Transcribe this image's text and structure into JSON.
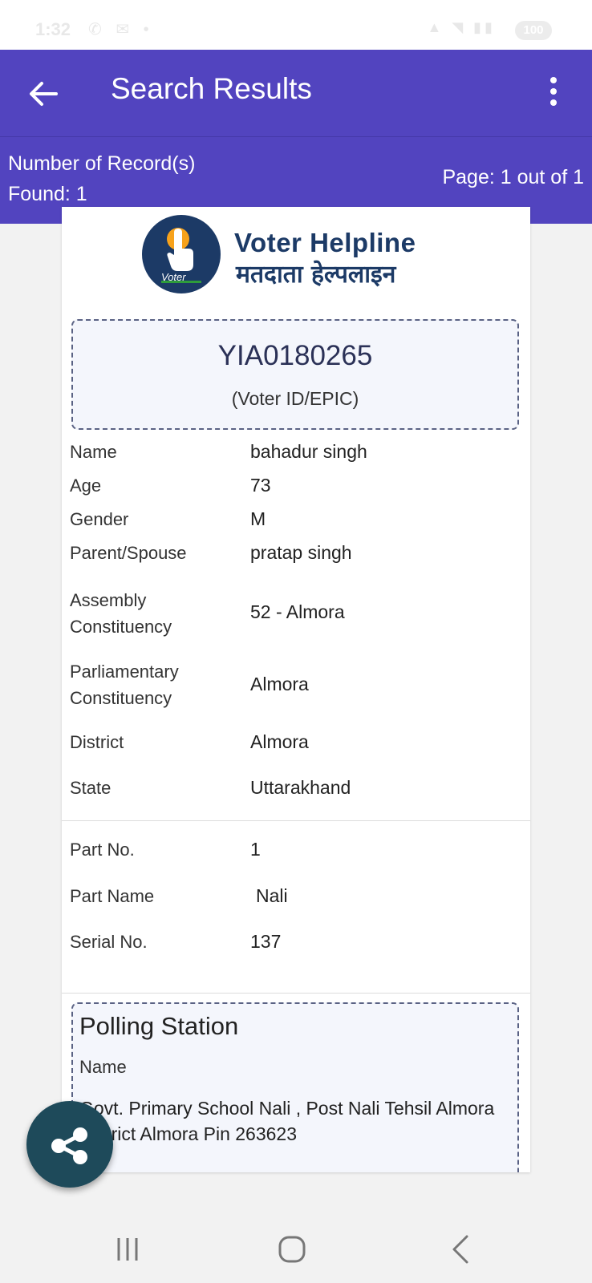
{
  "status_bar": {
    "time": "1:32",
    "battery": "100"
  },
  "app_bar": {
    "title": "Search Results"
  },
  "summary": {
    "records_found": "Number of Record(s) Found: 1",
    "page": "Page: 1 out of 1"
  },
  "logo": {
    "voter_badge": "Voter",
    "title_en": "Voter Helpline",
    "title_hi": "मतदाता हेल्पलाइन"
  },
  "epic": {
    "number": "YIA0180265",
    "label": "(Voter ID/EPIC)"
  },
  "details": [
    {
      "label": "Name",
      "value": "bahadur singh"
    },
    {
      "label": "Age",
      "value": "73"
    },
    {
      "label": "Gender",
      "value": "M"
    },
    {
      "label": "Parent/Spouse",
      "value": "pratap singh"
    },
    {
      "label": "Assembly Constituency",
      "value": "52 - Almora"
    },
    {
      "label": "Parliamentary Constituency",
      "value": "Almora"
    },
    {
      "label": "District",
      "value": "Almora"
    },
    {
      "label": "State",
      "value": "Uttarakhand"
    }
  ],
  "part_details": [
    {
      "label": "Part No.",
      "value": "1"
    },
    {
      "label": "Part Name",
      "value": "Nali"
    },
    {
      "label": "Serial No.",
      "value": "137"
    }
  ],
  "polling_station": {
    "title": "Polling Station",
    "name_label": "Name",
    "name_value": "Govt. Primary School Nali , Post Nali Tehsil Almora District Almora Pin 263623"
  },
  "icons": {
    "back": "arrow-left-icon",
    "menu": "more-vertical-icon",
    "share": "share-icon",
    "nav_recents": "recents-icon",
    "nav_home": "home-icon",
    "nav_back": "chevron-left-icon"
  },
  "colors": {
    "primary": "#5244bf",
    "logo_navy": "#1c3a66",
    "fab": "#1e4a5a",
    "box_border": "#5a6284"
  }
}
